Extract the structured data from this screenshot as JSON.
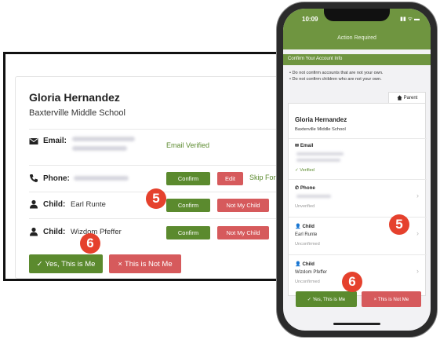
{
  "desktop": {
    "name": "Gloria Hernandez",
    "school": "Baxterville Middle School",
    "email": {
      "label": "Email:",
      "status": "Email Verified"
    },
    "phone": {
      "label": "Phone:",
      "confirm": "Confirm",
      "edit": "Edit",
      "skip": "Skip For"
    },
    "children": [
      {
        "label": "Child:",
        "value": "Earl Runte",
        "confirm": "Confirm",
        "not_mine": "Not My Child"
      },
      {
        "label": "Child:",
        "value": "Wizdom Pfeffer",
        "confirm": "Confirm",
        "not_mine": "Not My Child"
      }
    ],
    "yes_button": "Yes, This is Me",
    "no_button": "This is Not Me"
  },
  "phone": {
    "time": "10:09",
    "status_icons": "▮▮ ᯤ ▬",
    "header_title": "Action Required",
    "banner": "Confirm Your Account Info",
    "notes": [
      "• Do not confirm accounts that are not your own.",
      "• Do not confirm children who are not your own."
    ],
    "tab": "Parent",
    "name": "Gloria Hernandez",
    "school": "Baxterville Middle School",
    "email": {
      "label": "Email",
      "status": "✓ Verified"
    },
    "phone_row": {
      "label": "Phone",
      "status": "Unverified"
    },
    "children": [
      {
        "label": "Child",
        "value": "Earl Runte",
        "status": "Unconfirmed"
      },
      {
        "label": "Child",
        "value": "Wizdom Pfeffer",
        "status": "Unconfirmed"
      }
    ],
    "yes_button": "✓ Yes, This is Me",
    "no_button": "× This is Not Me"
  },
  "badges": {
    "step5": "5",
    "step6": "6"
  },
  "colors": {
    "green": "#5b8a2e",
    "red": "#d65a5c",
    "header_green": "#6f9540",
    "badge": "#e5412d"
  }
}
